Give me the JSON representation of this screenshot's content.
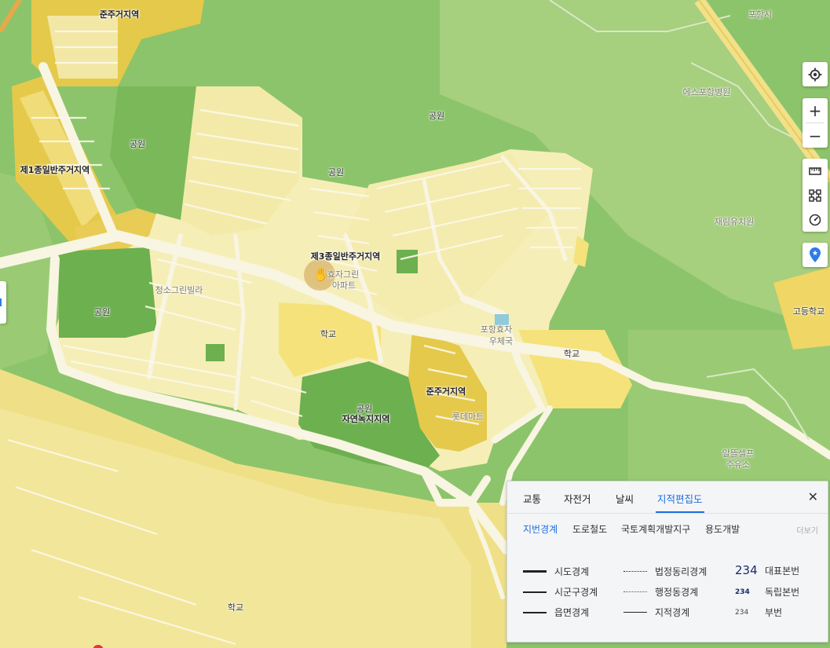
{
  "map": {
    "colors": {
      "park": "#8cc46b",
      "park_dark": "#6db04f",
      "residential_light": "#f6eeb7",
      "residential_zone": "#efe29a",
      "quasi_residential": "#e5c94a",
      "school": "#f5e27a",
      "road": "#f9f5e3",
      "mountain_green": "#a6cf7e"
    },
    "labels": {
      "zone_quasi_top": "준주거지역",
      "zone_type1": "제1종일반주거지역",
      "zone_type3": "제3종일반주거지역",
      "zone_quasi_center": "준주거지역",
      "zone_natural_green": "자연녹지지역",
      "park_1": "공원",
      "park_2": "공원",
      "park_3": "공원",
      "park_4": "공원",
      "park_5": "공원",
      "school_1": "학교",
      "school_2": "학교",
      "school_3": "학교",
      "high_school": "고등학교",
      "faint_1": "포항효자",
      "faint_2": "우체국",
      "faint_3": "재림유치원",
      "faint_4": "에스포항병원",
      "faint_5": "롯데마트",
      "faint_6": "포항시",
      "faint_7": "알뜰셀프",
      "faint_8": "주유소",
      "faint_9": "청소그린빌라",
      "faint_10": "효자그린",
      "faint_11": "아파트"
    }
  },
  "controls": {
    "locate_icon": "crosshair-icon",
    "zoom_in": "+",
    "zoom_out": "−",
    "ruler_icon": "ruler-icon",
    "area_icon": "area-icon",
    "radius_icon": "compass-icon",
    "pin_icon": "map-pin-icon"
  },
  "panel": {
    "tabs": [
      "교통",
      "자전거",
      "날씨",
      "지적편집도"
    ],
    "active_tab": "지적편집도",
    "close": "✕",
    "sub_tabs": [
      "지번경계",
      "도로철도",
      "국토계획개발지구",
      "용도개발"
    ],
    "more": "더보기",
    "legend": {
      "col1": [
        "시도경계",
        "시군구경계",
        "읍면경계"
      ],
      "col2": [
        "법정동리경계",
        "행정동경계",
        "지적경계"
      ],
      "col3_nums": [
        "234",
        "234",
        "234"
      ],
      "col3_labels": [
        "대표본번",
        "독립본번",
        "부번"
      ]
    },
    "accent": "#1f6fe0"
  }
}
